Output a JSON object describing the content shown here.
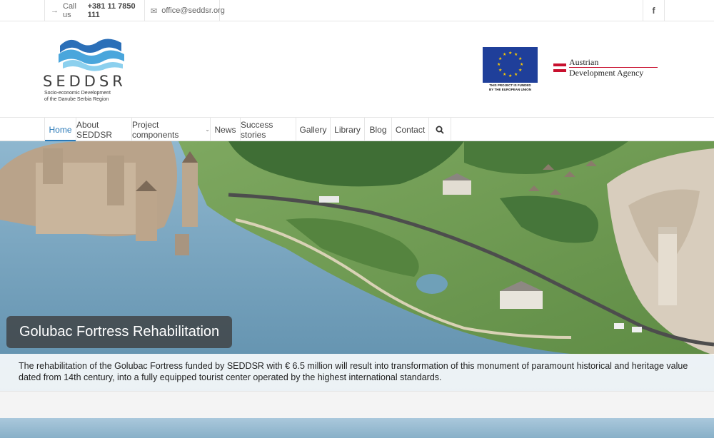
{
  "topbar": {
    "call_label": "Call us",
    "phone": "+381 11 7850 111",
    "email": "office@seddsr.org",
    "facebook_icon": "facebook-icon"
  },
  "logo": {
    "brand": "SEDDSR",
    "tagline_1": "Socio-economic Development",
    "tagline_2": "of the Danube Serbia Region"
  },
  "partners": {
    "eu_caption_1": "THIS PROJECT IS FUNDED",
    "eu_caption_2": "BY THE EUROPEAN UNION",
    "ada_line_1": "Austrian",
    "ada_line_2": "Development Agency"
  },
  "nav": {
    "items": [
      {
        "label": "Home"
      },
      {
        "label": "About SEDDSR"
      },
      {
        "label": "Project components"
      },
      {
        "label": "News"
      },
      {
        "label": "Success stories"
      },
      {
        "label": "Gallery"
      },
      {
        "label": "Library"
      },
      {
        "label": "Blog"
      },
      {
        "label": "Contact"
      }
    ],
    "search_icon": "search-icon"
  },
  "hero": {
    "title": "Golubac Fortress Rehabilitation",
    "caption": "The rehabilitation of the Golubac Fortress funded by SEDDSR with € 6.5 million will result into transformation of this monument of paramount historical and heritage value dated from 14th century, into a fully equipped tourist center operated by the highest international standards."
  },
  "colors": {
    "accent": "#2a7ab8",
    "eu_blue": "#1f3f9a",
    "eu_star": "#ffcc00",
    "austria_red": "#c8102e"
  }
}
